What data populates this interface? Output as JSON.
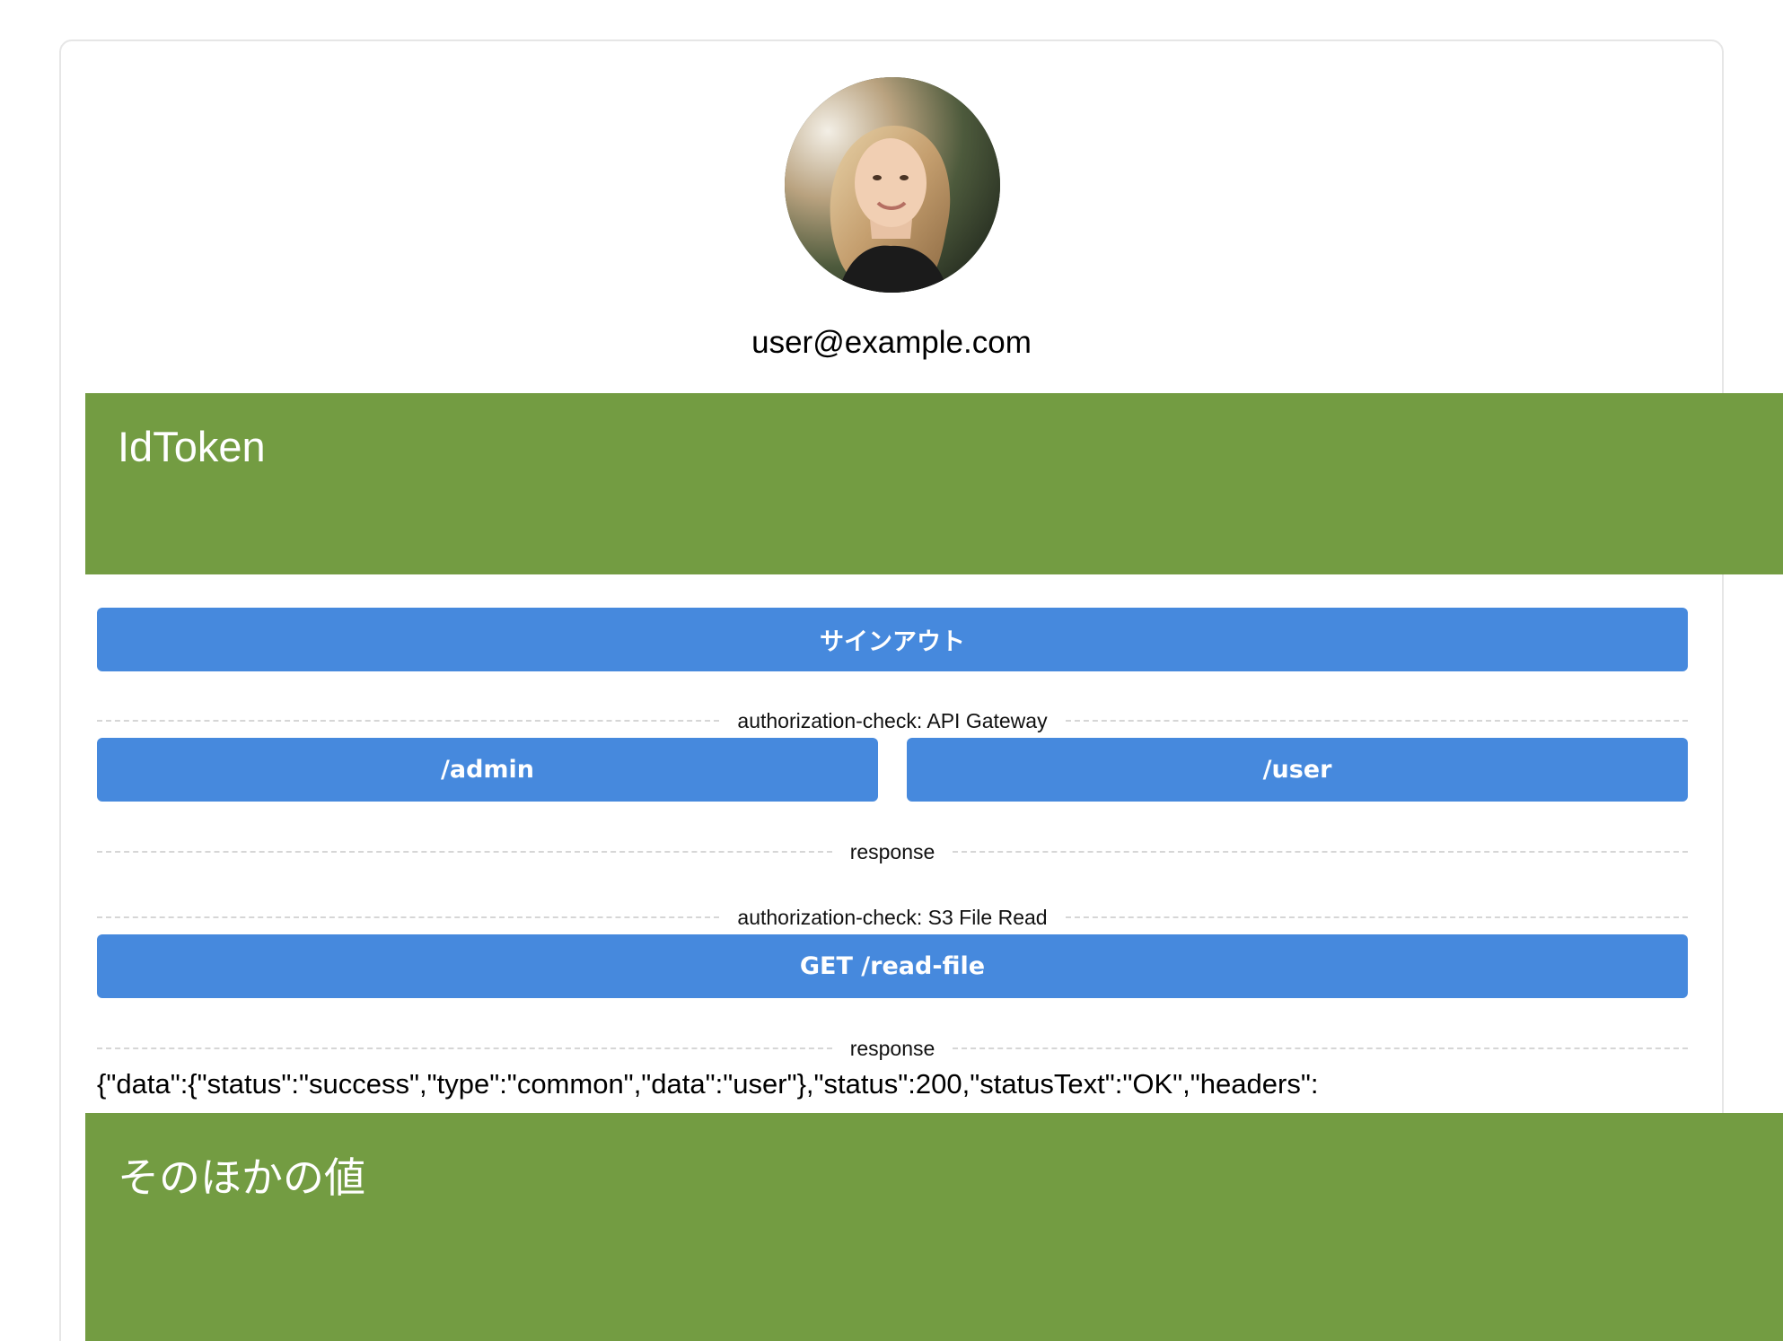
{
  "profile": {
    "email": "user@example.com",
    "avatar_icon": "user-photo"
  },
  "panels": {
    "idtoken_title": "IdToken",
    "other_title": "そのほかの値",
    "color": "#739c42"
  },
  "buttons": {
    "signout_label": "サインアウト",
    "admin_label": "/admin",
    "user_label": "/user",
    "readfile_label": "GET /read-file",
    "color": "#4689dd"
  },
  "sections": {
    "api_gateway_label": "authorization-check: API Gateway",
    "response_label_1": "response",
    "s3_label": "authorization-check: S3 File Read",
    "response_label_2": "response"
  },
  "responses": {
    "read_file": "{\"data\":{\"status\":\"success\",\"type\":\"common\",\"data\":\"user\"},\"status\":200,\"statusText\":\"OK\",\"headers\":"
  }
}
